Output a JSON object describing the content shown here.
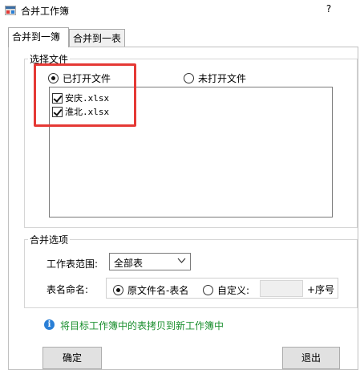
{
  "window": {
    "title": "合并工作簿",
    "help_label": "?"
  },
  "tabs": [
    {
      "label": "合并到一簿",
      "active": true
    },
    {
      "label": "合并到一表",
      "active": false
    }
  ],
  "file_group": {
    "legend": "选择文件",
    "radio_opened": "已打开文件",
    "radio_unopened": "未打开文件",
    "selected": "已打开文件",
    "files": [
      {
        "name": "安庆.xlsx",
        "checked": true
      },
      {
        "name": "淮北.xlsx",
        "checked": true
      }
    ]
  },
  "options_group": {
    "legend": "合并选项",
    "sheet_range_label": "工作表范围:",
    "sheet_range_value": "全部表",
    "naming_label": "表名命名:",
    "naming_option_original": "原文件名-表名",
    "naming_option_custom": "自定义:",
    "custom_value": "",
    "suffix_label": "+序号"
  },
  "info_text": "将目标工作簿中的表拷贝到新工作簿中",
  "buttons": {
    "ok": "确定",
    "exit": "退出"
  },
  "colors": {
    "highlight_box": "#e53935",
    "info_text": "#1a8f2e",
    "info_icon": "#2a7fd6"
  }
}
